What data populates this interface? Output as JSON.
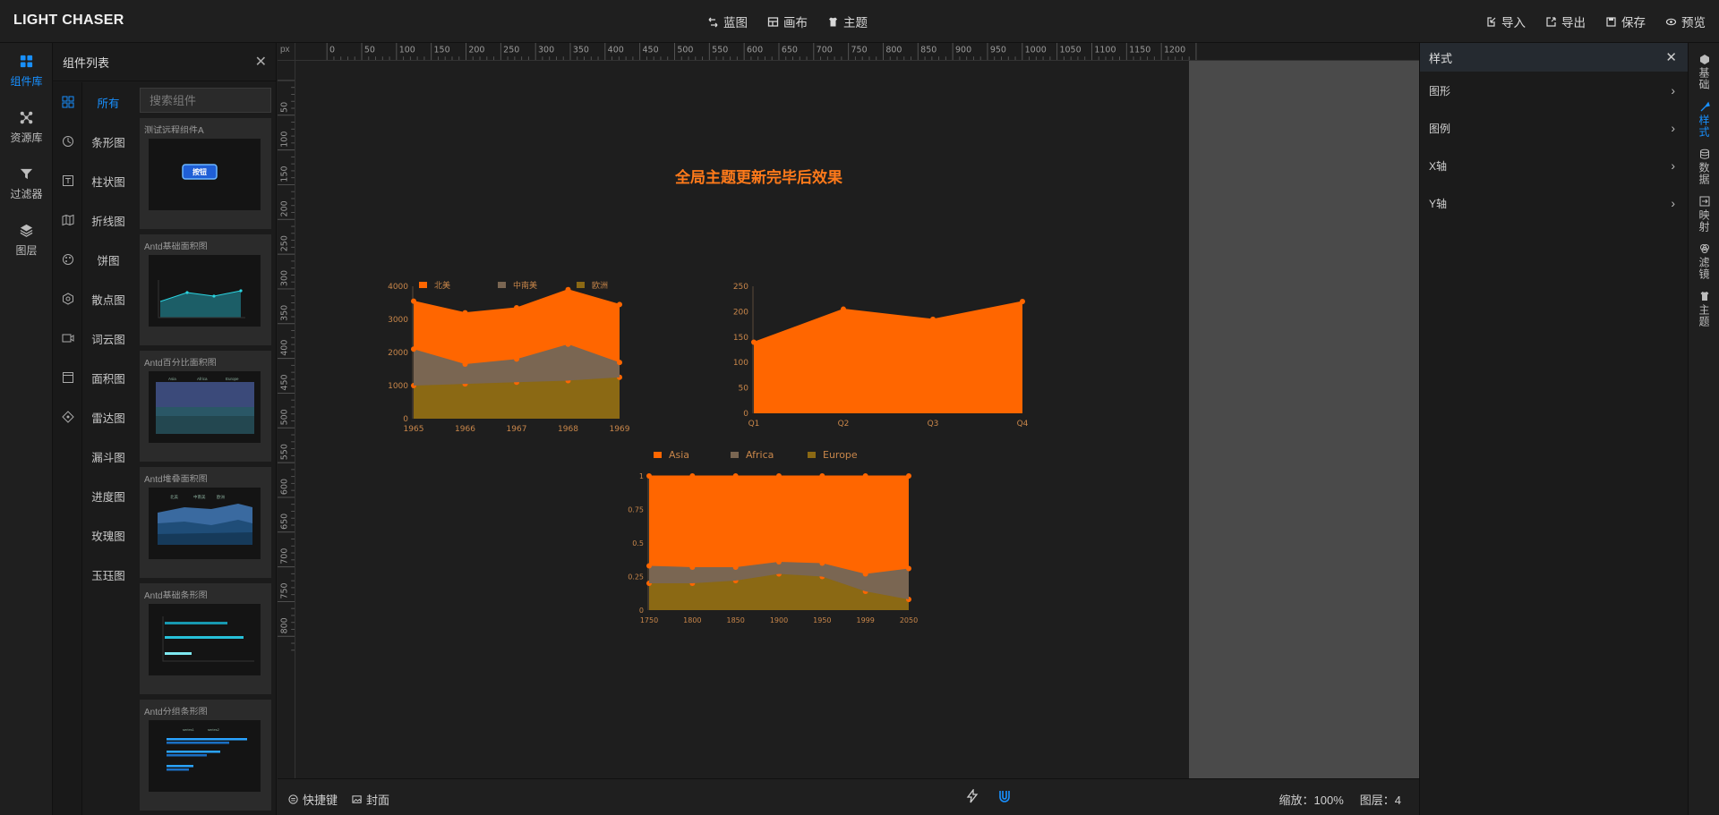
{
  "app": {
    "title": "LIGHT CHASER"
  },
  "header": {
    "center": [
      {
        "id": "blueprint",
        "label": "蓝图",
        "icon": "blueprint-icon"
      },
      {
        "id": "canvas",
        "label": "画布",
        "icon": "canvas-icon"
      },
      {
        "id": "theme",
        "label": "主题",
        "icon": "theme-icon"
      }
    ],
    "right": [
      {
        "id": "import",
        "label": "导入",
        "icon": "import-icon"
      },
      {
        "id": "export",
        "label": "导出",
        "icon": "export-icon"
      },
      {
        "id": "save",
        "label": "保存",
        "icon": "save-icon"
      },
      {
        "id": "preview",
        "label": "预览",
        "icon": "preview-icon"
      }
    ]
  },
  "left_nav": [
    {
      "label": "组件库",
      "icon": "component-library-icon",
      "active": true
    },
    {
      "label": "资源库",
      "icon": "resource-library-icon",
      "active": false
    },
    {
      "label": "过滤器",
      "icon": "filter-icon",
      "active": false
    },
    {
      "label": "图层",
      "icon": "layers-icon",
      "active": false
    }
  ],
  "component_panel": {
    "title": "组件列表",
    "search_placeholder": "搜索组件",
    "categories": [
      "所有",
      "条形图",
      "柱状图",
      "折线图",
      "饼图",
      "散点图",
      "词云图",
      "面积图",
      "雷达图",
      "漏斗图",
      "进度图",
      "玫瑰图",
      "玉珏图"
    ],
    "active_category": "所有",
    "cards": [
      {
        "title": "测试远程组件A",
        "button_label": "按钮"
      },
      {
        "title": "Antd基础面积图"
      },
      {
        "title": "Antd百分比面积图",
        "legend": [
          "Asia",
          "Africa",
          "Europe"
        ]
      },
      {
        "title": "Antd堆叠面积图",
        "legend": [
          "北美",
          "中南美",
          "欧洲"
        ]
      },
      {
        "title": "Antd基础条形图"
      },
      {
        "title": "Antd分组条形图",
        "legend": [
          "series1",
          "series2"
        ]
      }
    ]
  },
  "ruler": {
    "unit": "px",
    "h_ticks": [
      0,
      50,
      100,
      150,
      200,
      250,
      300,
      350,
      400,
      450,
      500,
      550,
      600,
      650,
      700,
      750,
      800,
      850,
      900,
      950,
      1000,
      1050,
      1100,
      1150,
      1200
    ],
    "v_ticks": [
      50,
      100,
      150,
      200,
      250,
      300,
      350,
      400,
      450,
      500,
      550,
      600,
      650,
      700,
      750,
      800
    ]
  },
  "stage": {
    "title": "全局主题更新完毕后效果"
  },
  "chart_data": [
    {
      "type": "area",
      "stacked": true,
      "categories": [
        "1965",
        "1966",
        "1967",
        "1968",
        "1969"
      ],
      "series": [
        {
          "name": "欧洲",
          "values": [
            1000,
            1050,
            1100,
            1150,
            1250
          ],
          "color": "#8b6914"
        },
        {
          "name": "中南美",
          "values": [
            1100,
            600,
            700,
            1100,
            450
          ],
          "color": "#7a6652"
        },
        {
          "name": "北美",
          "values": [
            1450,
            1550,
            1550,
            1650,
            1750
          ],
          "color": "#ff6600"
        }
      ],
      "legend": [
        "北美",
        "中南美",
        "欧洲"
      ],
      "y_ticks": [
        0,
        1000,
        2000,
        3000,
        4000
      ],
      "ylim": [
        0,
        4000
      ]
    },
    {
      "type": "area",
      "categories": [
        "Q1",
        "Q2",
        "Q3",
        "Q4"
      ],
      "series": [
        {
          "values": [
            140,
            205,
            185,
            220
          ],
          "color": "#ff6600"
        }
      ],
      "y_ticks": [
        0,
        50,
        100,
        150,
        200,
        250
      ],
      "ylim": [
        0,
        250
      ]
    },
    {
      "type": "area",
      "percent": true,
      "categories": [
        "1750",
        "1800",
        "1850",
        "1900",
        "1950",
        "1999",
        "2050"
      ],
      "series": [
        {
          "name": "Europe",
          "values": [
            0.2,
            0.2,
            0.22,
            0.27,
            0.25,
            0.14,
            0.08
          ],
          "color": "#8b6914"
        },
        {
          "name": "Africa",
          "values": [
            0.13,
            0.12,
            0.1,
            0.09,
            0.1,
            0.13,
            0.23
          ],
          "color": "#7a6652"
        },
        {
          "name": "Asia",
          "values": [
            0.67,
            0.68,
            0.68,
            0.64,
            0.65,
            0.73,
            0.69
          ],
          "color": "#ff6600"
        }
      ],
      "legend": [
        "Asia",
        "Africa",
        "Europe"
      ],
      "y_ticks": [
        0,
        0.25,
        0.5,
        0.75,
        1
      ],
      "ylim": [
        0,
        1
      ]
    }
  ],
  "bottom_bar": {
    "left": [
      {
        "label": "快捷键",
        "icon": "shortcut-icon"
      },
      {
        "label": "封面",
        "icon": "cover-icon"
      }
    ],
    "zoom": "缩放：100%",
    "layers": "图层：4"
  },
  "style_panel": {
    "title": "样式",
    "rows": [
      "图形",
      "图例",
      "X轴",
      "Y轴"
    ]
  },
  "right_nav": [
    {
      "label": "基础",
      "icon": "basic-icon",
      "active": false
    },
    {
      "label": "样式",
      "icon": "style-icon",
      "active": true
    },
    {
      "label": "数据",
      "icon": "data-icon",
      "active": false
    },
    {
      "label": "映射",
      "icon": "mapping-icon",
      "active": false
    },
    {
      "label": "滤镜",
      "icon": "filter-effect-icon",
      "active": false
    },
    {
      "label": "主题",
      "icon": "theme-side-icon",
      "active": false
    }
  ],
  "colors": {
    "accent": "#1890ff",
    "chart_primary": "#ff6600",
    "title": "#ff7a1a",
    "axis_text": "#c8864a"
  }
}
